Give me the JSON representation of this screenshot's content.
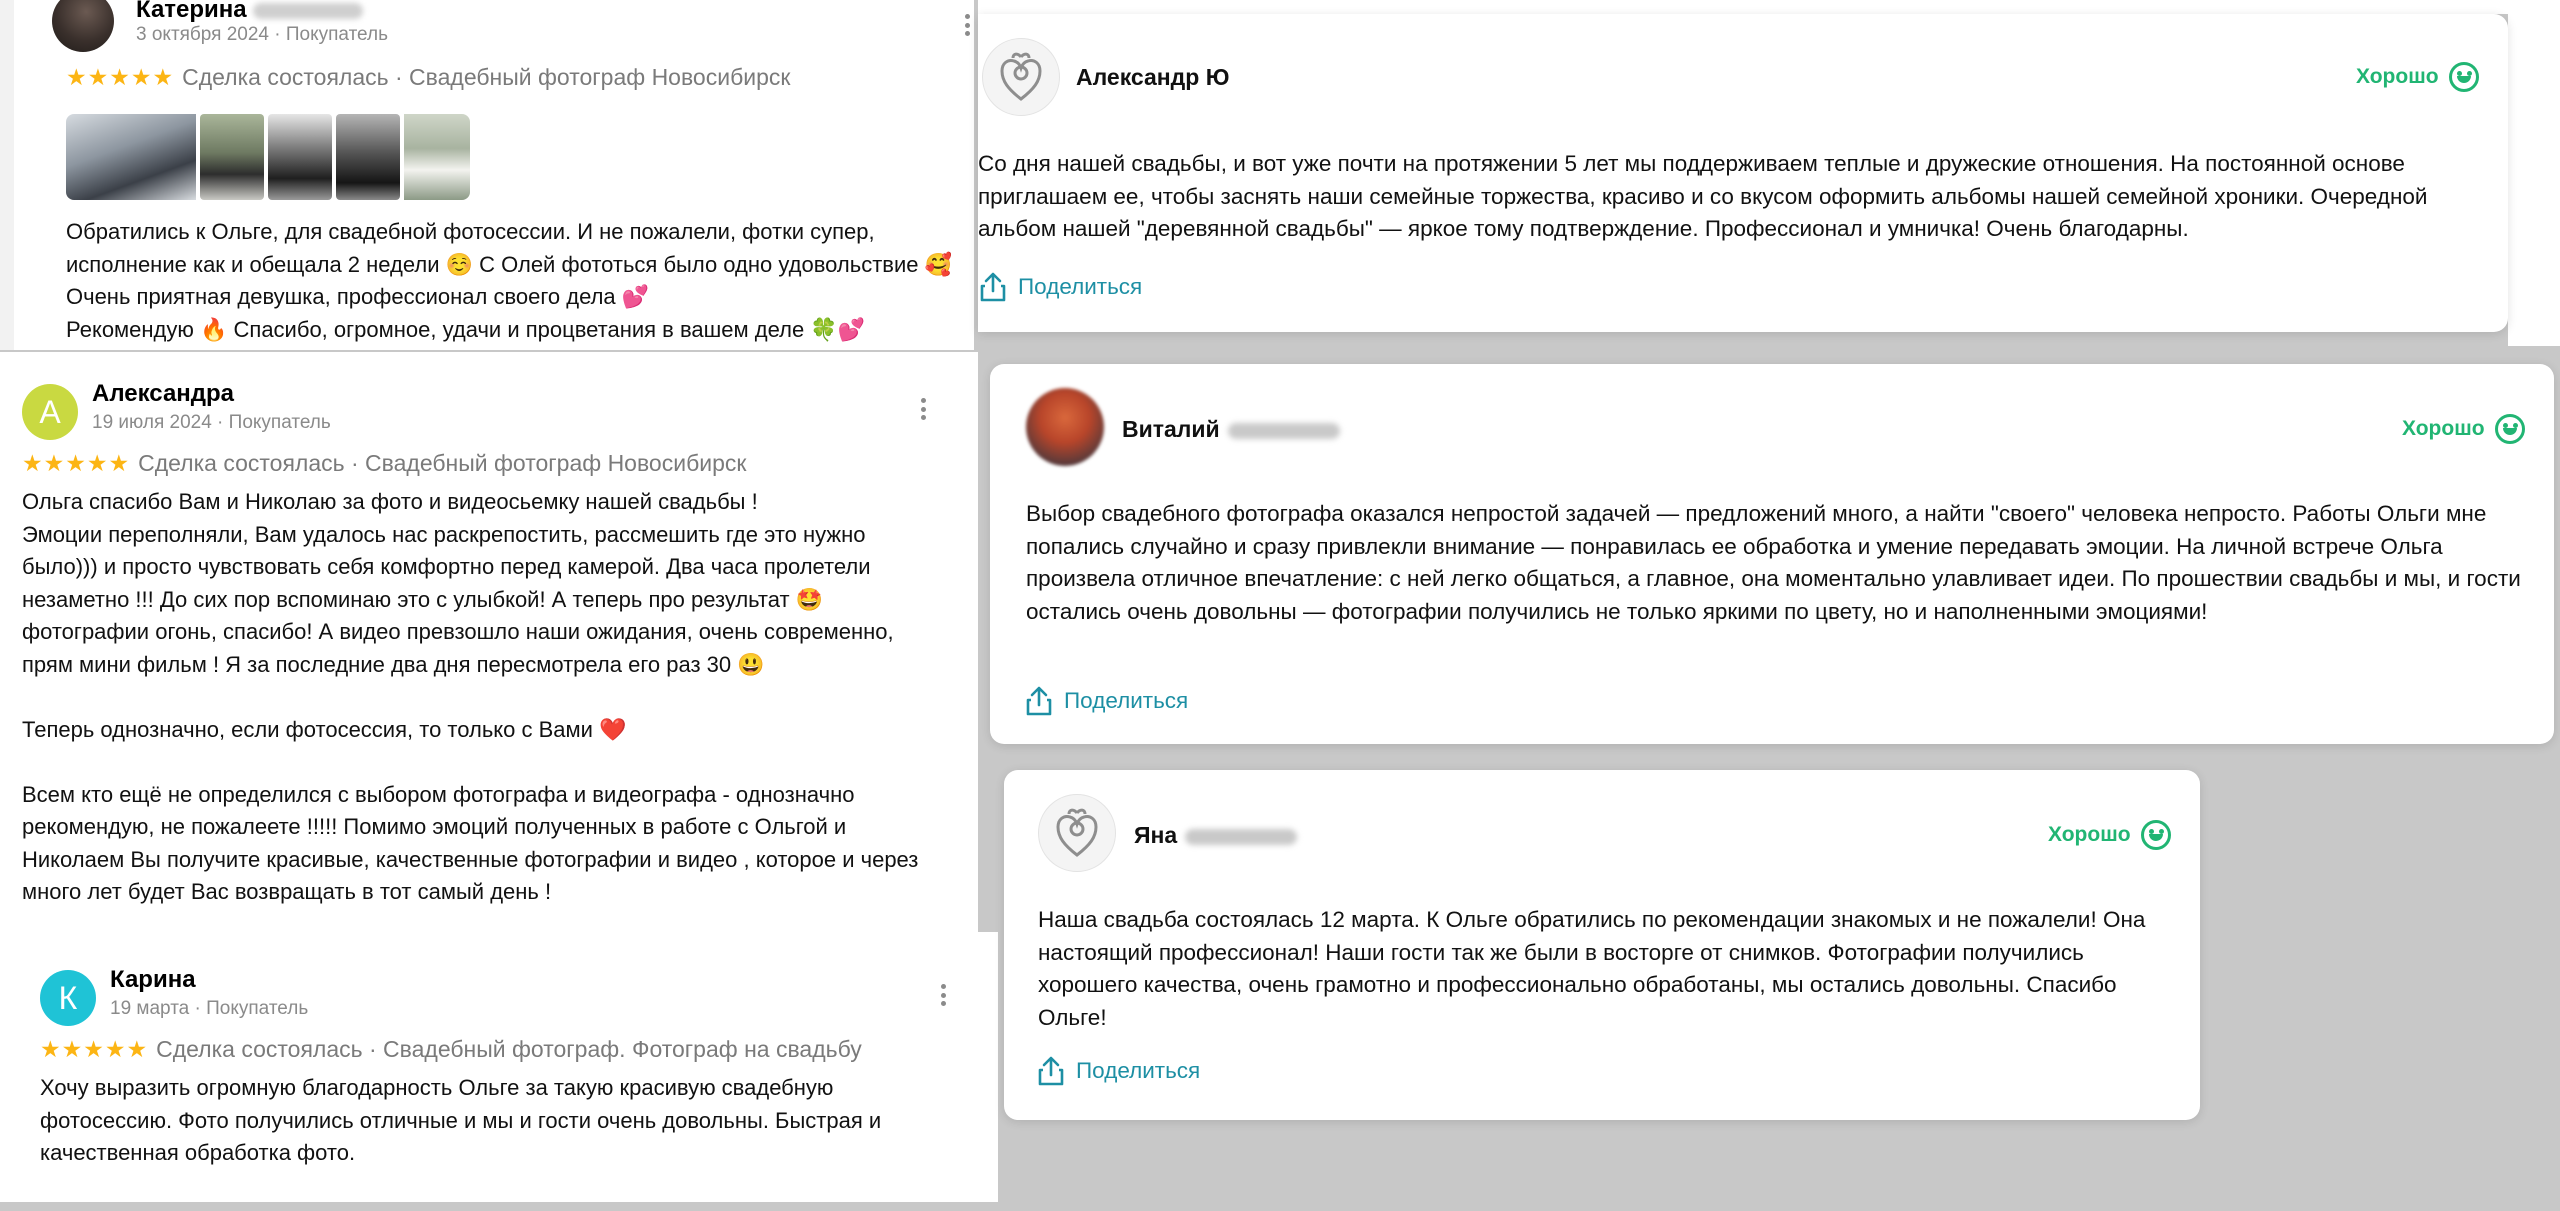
{
  "left_reviews": [
    {
      "name": "Катерина",
      "meta": "3 октября 2024 · Покупатель",
      "stars": "★★★★★",
      "deal": "Сделка состоялась · Свадебный фотограф Новосибирск",
      "text": "Обратились к Ольге, для свадебной фотосессии. И не пожалели, фотки супер,\nисполнение как и обещала 2 недели ☺️ С Олей фототься было одно удовольствие 🥰\nОчень приятная девушка, профессионал своего дела 💕\nРекомендую 🔥 Спасибо, огромное, удачи и процветания в вашем деле 🍀💕"
    },
    {
      "name": "Александра",
      "avatar_letter": "А",
      "meta": "19 июля 2024 · Покупатель",
      "stars": "★★★★★",
      "deal": "Сделка состоялась · Свадебный фотограф Новосибирск",
      "text": "Ольга спасибо Вам и Николаю за фото и видеосьемку нашей свадьбы !\nЭмоции переполняли, Вам удалось нас раскрепостить, рассмешить где это нужно\nбыло))) и просто чувствовать себя комфортно перед камерой. Два часа пролетели\nнезаметно !!! До сих пор вспоминаю это с улыбкой! А теперь про результат 🤩\nфотографии огонь, спасибо! А видео превзошло наши ожидания, очень современно,\nпрям мини фильм ! Я за последние два дня пересмотрела его раз 30 😃\n\nТеперь однозначно, если фотосессия, то только с Вами ❤️\n\nВсем кто ещё не определился с выбором фотографа и видеографа - однозначно\nрекомендую, не пожалеете !!!!! Помимо эмоций полученных в работе с Ольгой и\nНиколаем Вы получите красивые, качественные фотографии и видео , которое и через\nмного лет будет Вас возвращать в тот самый день !"
    },
    {
      "name": "Карина",
      "avatar_letter": "К",
      "meta": "19 марта · Покупатель",
      "stars": "★★★★★",
      "deal": "Сделка состоялась · Свадебный фотограф. Фотограф на свадьбу",
      "text": "Хочу выразить огромную благодарность Ольге за такую красивую свадебную\nфотосессию. Фото получились отличные и мы и гости очень довольны. Быстрая и\nкачественная обработка фото."
    }
  ],
  "right_reviews": [
    {
      "name": "Александр Ю",
      "rating": "Хорошо",
      "text": "Со дня нашей свадьбы, и вот уже почти на протяжении 5 лет мы поддерживаем теплые и дружеские отношения. На постоянной основе приглашаем ее, чтобы заснять наши семейные торжества, красиво и со вкусом оформить альбомы нашей семейной хроники. Очередной альбом нашей \"деревянной свадьбы\" — яркое тому подтверждение. Профессионал и умничка! Очень благодарны.",
      "share": "Поделиться"
    },
    {
      "name": "Виталий",
      "rating": "Хорошо",
      "text": "Выбор свадебного фотографа оказался непростой задачей — предложений много, а найти \"своего\" человека непросто. Работы Ольги мне попались случайно и сразу привлекли внимание — понравилась ее обработка и умение передавать эмоции. На личной встрече Ольга произвела отличное впечатление: с ней легко общаться, а главное, она моментально улавливает идеи. По прошествии свадьбы и мы, и гости остались очень довольны — фотографии получились не только яркими по цвету, но и наполненными эмоциями!",
      "share": "Поделиться"
    },
    {
      "name": "Яна",
      "rating": "Хорошо",
      "text": "Наша свадьба состоялась 12 марта. К Ольге обратились по рекомендации знакомых и не пожалели! Она настоящий профессионал! Наши гости так же были в восторге от снимков. Фотографии получились хорошего качества, очень грамотно и профессионально обработаны, мы остались довольны. Спасибо Ольге!",
      "share": "Поделиться"
    }
  ],
  "colors": {
    "star": "#fcb514",
    "good_green": "#21b573",
    "share_teal": "#1d8fa4",
    "avatar_a": "#c9d941",
    "avatar_k": "#1fc3d6"
  },
  "icons": [
    "kebab-menu-icon",
    "share-icon",
    "smile-icon",
    "logo-heart-icon"
  ]
}
